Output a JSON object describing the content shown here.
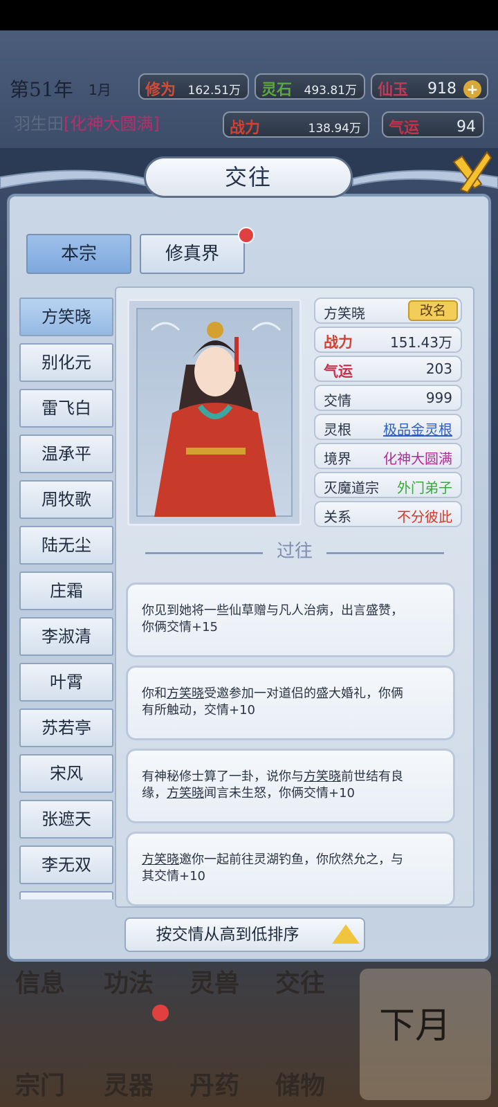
{
  "hud": {
    "year": "第51年",
    "month": "1月",
    "resources": [
      {
        "label": "修为",
        "value": "162.51万",
        "color": "#d64a38"
      },
      {
        "label": "灵石",
        "value": "493.81万",
        "color": "#5ca83a"
      },
      {
        "label": "仙玉",
        "value": "918",
        "color": "#c23a5a"
      }
    ],
    "player_name": "羽生田",
    "player_realm": "[化神大圆满]",
    "combat_label": "战力",
    "combat_value": "138.94万",
    "luck_label": "气运",
    "luck_value": "94"
  },
  "dialog": {
    "title": "交往",
    "tabs": [
      "本宗",
      "修真界"
    ]
  },
  "characters": [
    "方笑晓",
    "别化元",
    "雷飞白",
    "温承平",
    "周牧歌",
    "陆无尘",
    "庄霜",
    "李淑清",
    "叶霄",
    "苏若亭",
    "宋风",
    "张遮天",
    "李无双"
  ],
  "detail": {
    "name": "方笑晓",
    "rename": "改名",
    "stats": [
      {
        "k": "战力",
        "v": "151.43万",
        "kcolor": "#d4402f",
        "vcolor": "#2a3446"
      },
      {
        "k": "气运",
        "v": "203",
        "kcolor": "#c8304a",
        "vcolor": "#2a3446"
      },
      {
        "k": "交情",
        "v": "999",
        "kcolor": "#2a3446",
        "vcolor": "#2a3446"
      },
      {
        "k": "灵根",
        "v": "极品金灵根",
        "kcolor": "#2a3446",
        "vcolor": "#2f5fc4"
      },
      {
        "k": "境界",
        "v": "化神大圆满",
        "kcolor": "#2a3446",
        "vcolor": "#b52a9a"
      },
      {
        "k": "灭魔道宗",
        "v": "外门弟子",
        "kcolor": "#2a3446",
        "vcolor": "#3aa83a"
      },
      {
        "k": "关系",
        "v": "不分彼此",
        "kcolor": "#2a3446",
        "vcolor": "#d13a2a"
      }
    ],
    "past_title": "过往",
    "events": [
      {
        "line1": "你见到她将一些仙草赠与凡人治病，出言盛赞，",
        "line2": "你俩交情+15"
      },
      {
        "pre": "你和",
        "name1": "方笑晓",
        "mid": "受邀参加一对道侣的盛大婚礼，你俩",
        "line2": "有所触动，交情+10"
      },
      {
        "pre": "有神秘修士算了一卦，说你与",
        "name1": "方笑晓",
        "mid": "前世结有良",
        "line2a": "缘，",
        "name2": "方笑晓",
        "line2b": "闻言未生怒，你俩交情+10"
      },
      {
        "name1": "方笑晓",
        "mid": "邀你一起前往灵湖钓鱼，你欣然允之，与",
        "line2": "其交情+10"
      }
    ]
  },
  "sort_label": "按交情从高到低排序",
  "nav": {
    "row1": [
      "信息",
      "功法",
      "灵兽",
      "交往"
    ],
    "row2": [
      "宗门",
      "灵器",
      "丹药",
      "储物"
    ],
    "next_month": "下月"
  }
}
